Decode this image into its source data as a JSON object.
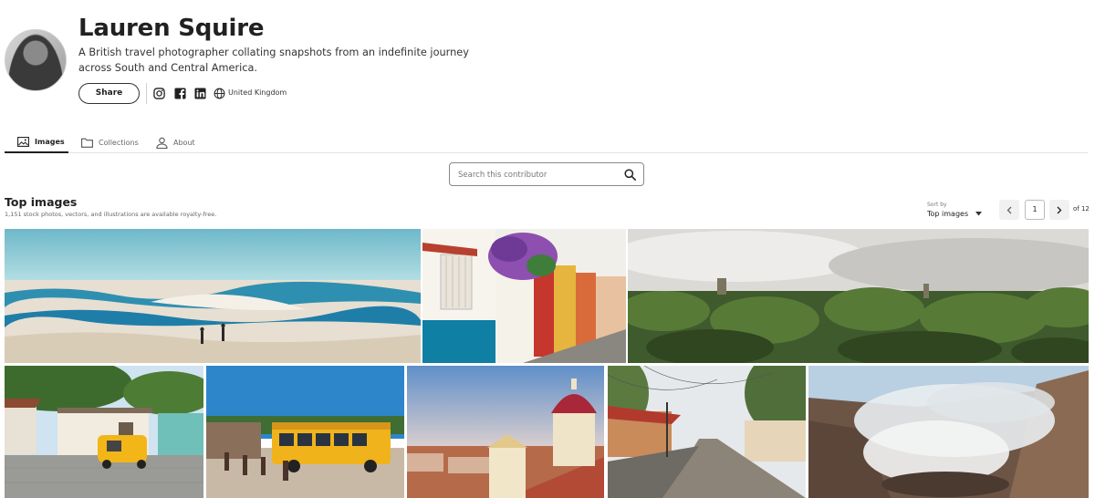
{
  "profile": {
    "name": "Lauren Squire",
    "bio": "A British travel photographer collating snapshots from an indefinite journey across South and Central America.",
    "share_label": "Share",
    "country": "United Kingdom",
    "social_icons": [
      "instagram-icon",
      "facebook-icon",
      "linkedin-icon",
      "globe-icon"
    ]
  },
  "tabs": [
    {
      "label": "Images",
      "icon": "image-icon",
      "active": true
    },
    {
      "label": "Collections",
      "icon": "folder-icon",
      "active": false
    },
    {
      "label": "About",
      "icon": "person-icon",
      "active": false
    }
  ],
  "search": {
    "placeholder": "Search this contributor"
  },
  "section": {
    "title": "Top images",
    "subtitle": "1,151 stock photos, vectors, and illustrations are available royalty-free."
  },
  "sort": {
    "label": "Sort by",
    "value": "Top images"
  },
  "pagination": {
    "current": "1",
    "of_label": "of 12"
  },
  "images": [
    "desert-dunes-lagoons-photo",
    "colonial-street-flowers-photo",
    "jungle-canopy-ruins-photo",
    "yellow-tuktuk-house-photo",
    "yellow-school-bus-photo",
    "cathedral-dome-rooftops-photo",
    "cobbled-street-lights-photo",
    "volcano-crater-smoke-photo"
  ],
  "colors": {
    "text": "#212121",
    "muted": "#666666",
    "border": "#e2e2e2"
  }
}
